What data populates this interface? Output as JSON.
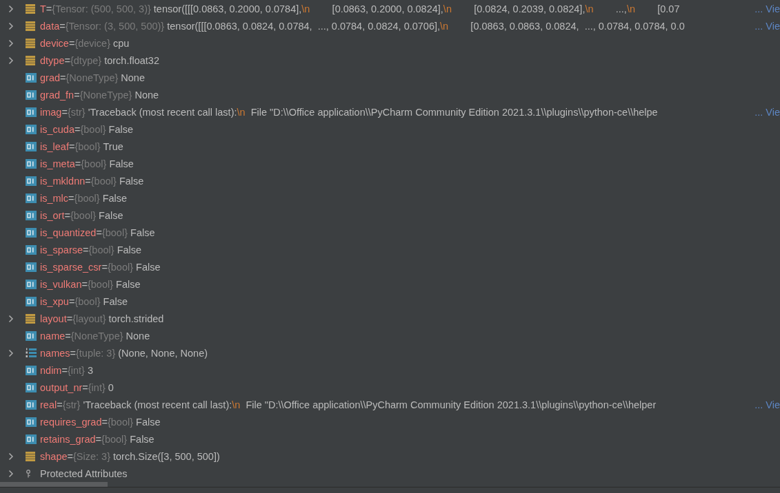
{
  "variables": [
    {
      "name": "T",
      "eq": "=",
      "kind": "object",
      "has_children": true,
      "type": "{Tensor: (500, 500, 3)}",
      "value": [
        {
          "kind": "text",
          "text": "tensor([[[0.0863, 0.2000, 0.0784],"
        },
        {
          "kind": "escape",
          "text": "\\n"
        },
        {
          "kind": "text",
          "text": "        [0.0863, 0.2000, 0.0824],"
        },
        {
          "kind": "escape",
          "text": "\\n"
        },
        {
          "kind": "text",
          "text": "        [0.0824, 0.2039, 0.0824],"
        },
        {
          "kind": "escape",
          "text": "\\n"
        },
        {
          "kind": "text",
          "text": "        ...,"
        },
        {
          "kind": "escape",
          "text": "\\n"
        },
        {
          "kind": "text",
          "text": "        [0.07"
        }
      ],
      "more": "... Vie"
    },
    {
      "name": "data",
      "eq": "=",
      "kind": "object",
      "has_children": true,
      "type": "{Tensor: (3, 500, 500)}",
      "value": [
        {
          "kind": "text",
          "text": "tensor([[[0.0863, 0.0824, 0.0784,  ..., 0.0784, 0.0824, 0.0706],"
        },
        {
          "kind": "escape",
          "text": "\\n"
        },
        {
          "kind": "text",
          "text": "        [0.0863, 0.0863, 0.0824,  ..., 0.0784, 0.0784, 0.0"
        }
      ],
      "more": "... Vie"
    },
    {
      "name": "device",
      "eq": "=",
      "kind": "object",
      "has_children": true,
      "type": "{device}",
      "value": [
        {
          "kind": "text",
          "text": "cpu"
        }
      ]
    },
    {
      "name": "dtype",
      "eq": "=",
      "kind": "object",
      "has_children": true,
      "type": "{dtype}",
      "value": [
        {
          "kind": "text",
          "text": "torch.float32"
        }
      ]
    },
    {
      "name": "grad",
      "eq": "=",
      "kind": "primitive",
      "has_children": false,
      "type": "{NoneType}",
      "value": [
        {
          "kind": "text",
          "text": "None"
        }
      ]
    },
    {
      "name": "grad_fn",
      "eq": "=",
      "kind": "primitive",
      "has_children": false,
      "type": "{NoneType}",
      "value": [
        {
          "kind": "text",
          "text": "None"
        }
      ]
    },
    {
      "name": "imag",
      "eq": "=",
      "kind": "primitive",
      "has_children": false,
      "type": "{str}",
      "value": [
        {
          "kind": "text",
          "text": "'Traceback (most recent call last):"
        },
        {
          "kind": "escape",
          "text": "\\n"
        },
        {
          "kind": "text",
          "text": "  File \"D:\\\\Office application\\\\PyCharm Community Edition 2021.3.1\\\\plugins\\\\python-ce\\\\helpe"
        }
      ],
      "more": "... Vie"
    },
    {
      "name": "is_cuda",
      "eq": "=",
      "kind": "primitive",
      "has_children": false,
      "type": "{bool}",
      "value": [
        {
          "kind": "text",
          "text": "False"
        }
      ]
    },
    {
      "name": "is_leaf",
      "eq": "=",
      "kind": "primitive",
      "has_children": false,
      "type": "{bool}",
      "value": [
        {
          "kind": "text",
          "text": "True"
        }
      ]
    },
    {
      "name": "is_meta",
      "eq": "=",
      "kind": "primitive",
      "has_children": false,
      "type": "{bool}",
      "value": [
        {
          "kind": "text",
          "text": "False"
        }
      ]
    },
    {
      "name": "is_mkldnn",
      "eq": "=",
      "kind": "primitive",
      "has_children": false,
      "type": "{bool}",
      "value": [
        {
          "kind": "text",
          "text": "False"
        }
      ]
    },
    {
      "name": "is_mlc",
      "eq": "=",
      "kind": "primitive",
      "has_children": false,
      "type": "{bool}",
      "value": [
        {
          "kind": "text",
          "text": "False"
        }
      ]
    },
    {
      "name": "is_ort",
      "eq": "=",
      "kind": "primitive",
      "has_children": false,
      "type": "{bool}",
      "value": [
        {
          "kind": "text",
          "text": "False"
        }
      ]
    },
    {
      "name": "is_quantized",
      "eq": "=",
      "kind": "primitive",
      "has_children": false,
      "type": "{bool}",
      "value": [
        {
          "kind": "text",
          "text": "False"
        }
      ]
    },
    {
      "name": "is_sparse",
      "eq": "=",
      "kind": "primitive",
      "has_children": false,
      "type": "{bool}",
      "value": [
        {
          "kind": "text",
          "text": "False"
        }
      ]
    },
    {
      "name": "is_sparse_csr",
      "eq": "=",
      "kind": "primitive",
      "has_children": false,
      "type": "{bool}",
      "value": [
        {
          "kind": "text",
          "text": "False"
        }
      ]
    },
    {
      "name": "is_vulkan",
      "eq": "=",
      "kind": "primitive",
      "has_children": false,
      "type": "{bool}",
      "value": [
        {
          "kind": "text",
          "text": "False"
        }
      ]
    },
    {
      "name": "is_xpu",
      "eq": "=",
      "kind": "primitive",
      "has_children": false,
      "type": "{bool}",
      "value": [
        {
          "kind": "text",
          "text": "False"
        }
      ]
    },
    {
      "name": "layout",
      "eq": "=",
      "kind": "object",
      "has_children": true,
      "type": "{layout}",
      "value": [
        {
          "kind": "text",
          "text": "torch.strided"
        }
      ]
    },
    {
      "name": "name",
      "eq": "=",
      "kind": "primitive",
      "has_children": false,
      "type": "{NoneType}",
      "value": [
        {
          "kind": "text",
          "text": "None"
        }
      ]
    },
    {
      "name": "names",
      "eq": "=",
      "kind": "list",
      "has_children": true,
      "type": "{tuple: 3}",
      "value": [
        {
          "kind": "text",
          "text": "(None, None, None)"
        }
      ]
    },
    {
      "name": "ndim",
      "eq": "=",
      "kind": "primitive",
      "has_children": false,
      "type": "{int}",
      "value": [
        {
          "kind": "text",
          "text": "3"
        }
      ]
    },
    {
      "name": "output_nr",
      "eq": "=",
      "kind": "primitive",
      "has_children": false,
      "type": "{int}",
      "value": [
        {
          "kind": "text",
          "text": "0"
        }
      ]
    },
    {
      "name": "real",
      "eq": "=",
      "kind": "primitive",
      "has_children": false,
      "type": "{str}",
      "value": [
        {
          "kind": "text",
          "text": "'Traceback (most recent call last):"
        },
        {
          "kind": "escape",
          "text": "\\n"
        },
        {
          "kind": "text",
          "text": "  File \"D:\\\\Office application\\\\PyCharm Community Edition 2021.3.1\\\\plugins\\\\python-ce\\\\helper"
        }
      ],
      "more": "... Vie"
    },
    {
      "name": "requires_grad",
      "eq": "=",
      "kind": "primitive",
      "has_children": false,
      "type": "{bool}",
      "value": [
        {
          "kind": "text",
          "text": "False"
        }
      ]
    },
    {
      "name": "retains_grad",
      "eq": "=",
      "kind": "primitive",
      "has_children": false,
      "type": "{bool}",
      "value": [
        {
          "kind": "text",
          "text": "False"
        }
      ]
    },
    {
      "name": "shape",
      "eq": "=",
      "kind": "object",
      "has_children": true,
      "type": "{Size: 3}",
      "value": [
        {
          "kind": "text",
          "text": "torch.Size([3, 500, 500])"
        }
      ]
    },
    {
      "name": "Protected Attributes",
      "kind": "group",
      "has_children": true
    }
  ]
}
